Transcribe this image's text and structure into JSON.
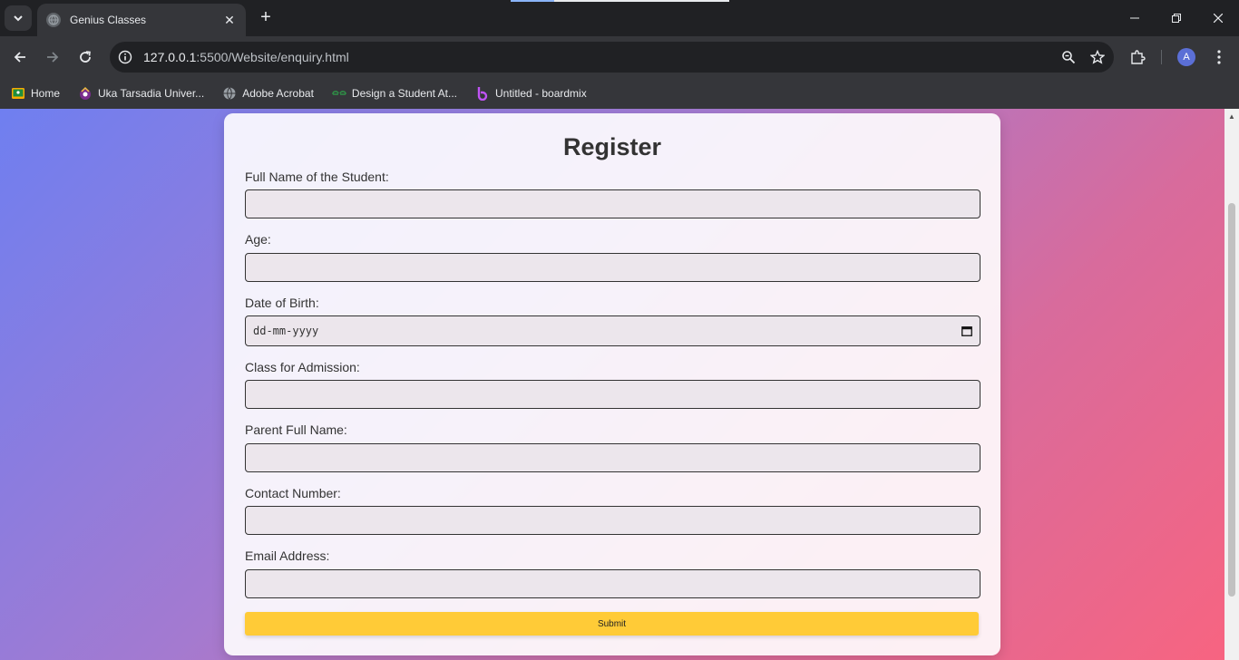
{
  "browser": {
    "tab_title": "Genius Classes",
    "url_host": "127.0.0.1",
    "url_rest": ":5500/Website/enquiry.html",
    "profile_initial": "A",
    "bookmarks": [
      {
        "label": "Home",
        "icon": "classroom-icon"
      },
      {
        "label": "Uka Tarsadia Univer...",
        "icon": "university-icon"
      },
      {
        "label": "Adobe Acrobat",
        "icon": "globe-icon"
      },
      {
        "label": "Design a Student At...",
        "icon": "geeksforgeeks-icon"
      },
      {
        "label": "Untitled - boardmix",
        "icon": "boardmix-icon"
      }
    ]
  },
  "form": {
    "title": "Register",
    "fields": [
      {
        "label": "Full Name of the Student:",
        "value": ""
      },
      {
        "label": "Age:",
        "value": ""
      },
      {
        "label": "Date of Birth:",
        "placeholder": "dd-mm-yyyy"
      },
      {
        "label": "Class for Admission:",
        "value": ""
      },
      {
        "label": "Parent Full Name:",
        "value": ""
      },
      {
        "label": "Contact Number:",
        "value": ""
      },
      {
        "label": "Email Address:",
        "value": ""
      }
    ],
    "submit_label": "Submit"
  },
  "colors": {
    "submit_bg": "#ffcb37",
    "gradient_start": "#6f7ff0",
    "gradient_end": "#f86480"
  }
}
